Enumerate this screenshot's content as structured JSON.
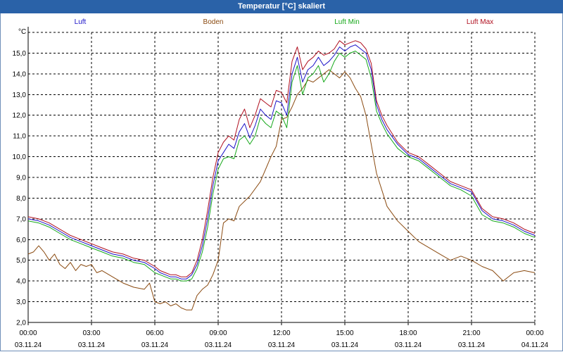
{
  "window": {
    "title": "Temperatur [°C] skaliert"
  },
  "colors": {
    "luft": "#1b12c8",
    "boden": "#8a4a10",
    "luft_min": "#16a81a",
    "luft_max": "#b01020",
    "titlebar": "#2a62a8"
  },
  "chart_data": {
    "type": "line",
    "title": "Temperatur [°C] skaliert",
    "ylabel": "°C",
    "xlabel": "",
    "ylim": [
      2.0,
      16.0
    ],
    "xlim": [
      0,
      24
    ],
    "grid": true,
    "legend_placement": "top",
    "y_ticks": [
      "2,0",
      "3,0",
      "4,0",
      "5,0",
      "6,0",
      "7,0",
      "8,0",
      "9,0",
      "10,0",
      "11,0",
      "12,0",
      "13,0",
      "14,0",
      "15,0"
    ],
    "x_ticks": [
      {
        "time": "00:00",
        "date": "03.11.24"
      },
      {
        "time": "03:00",
        "date": "03.11.24"
      },
      {
        "time": "06:00",
        "date": "03.11.24"
      },
      {
        "time": "09:00",
        "date": "03.11.24"
      },
      {
        "time": "12:00",
        "date": "03.11.24"
      },
      {
        "time": "15:00",
        "date": "03.11.24"
      },
      {
        "time": "18:00",
        "date": "03.11.24"
      },
      {
        "time": "21:00",
        "date": "03.11.24"
      },
      {
        "time": "00:00",
        "date": "04.11.24"
      }
    ],
    "series": [
      {
        "name": "Luft",
        "color": "#1b12c8",
        "x": [
          0,
          0.5,
          1,
          1.5,
          2,
          2.5,
          3,
          3.5,
          4,
          4.5,
          5,
          5.5,
          6,
          6.25,
          6.5,
          6.75,
          7,
          7.25,
          7.5,
          7.75,
          8,
          8.25,
          8.5,
          8.75,
          9,
          9.25,
          9.5,
          9.75,
          10,
          10.25,
          10.5,
          10.75,
          11,
          11.25,
          11.5,
          11.75,
          12,
          12.25,
          12.5,
          12.75,
          13,
          13.25,
          13.5,
          13.75,
          14,
          14.25,
          14.5,
          14.75,
          15,
          15.25,
          15.5,
          15.75,
          16,
          16.25,
          16.5,
          16.75,
          17,
          17.5,
          18,
          18.5,
          19,
          19.5,
          20,
          20.5,
          21,
          21.5,
          22,
          22.5,
          23,
          23.5,
          24
        ],
        "y": [
          7.0,
          6.9,
          6.7,
          6.4,
          6.1,
          5.9,
          5.7,
          5.5,
          5.3,
          5.2,
          5.0,
          4.9,
          4.6,
          4.4,
          4.3,
          4.2,
          4.2,
          4.1,
          4.1,
          4.3,
          4.8,
          5.7,
          7.0,
          8.6,
          9.8,
          10.2,
          10.6,
          10.4,
          11.2,
          11.6,
          10.9,
          11.5,
          12.3,
          12.0,
          11.8,
          12.7,
          12.6,
          12.0,
          14.0,
          14.8,
          13.6,
          14.2,
          14.4,
          14.8,
          14.4,
          14.6,
          14.9,
          15.3,
          15.1,
          15.3,
          15.4,
          15.2,
          15.0,
          14.2,
          12.5,
          11.8,
          11.3,
          10.6,
          10.1,
          9.9,
          9.5,
          9.1,
          8.7,
          8.5,
          8.3,
          7.4,
          7.0,
          6.9,
          6.7,
          6.4,
          6.2
        ]
      },
      {
        "name": "Boden",
        "color": "#8a4a10",
        "x": [
          0,
          0.25,
          0.5,
          0.75,
          1,
          1.25,
          1.5,
          1.75,
          2,
          2.25,
          2.5,
          2.75,
          3,
          3.25,
          3.5,
          4,
          4.5,
          5,
          5.5,
          5.75,
          6,
          6.25,
          6.5,
          6.75,
          7,
          7.25,
          7.5,
          7.75,
          8,
          8.25,
          8.5,
          8.75,
          9,
          9.25,
          9.5,
          9.75,
          10,
          10.5,
          11,
          11.5,
          11.75,
          12,
          12.25,
          12.5,
          12.75,
          13,
          13.25,
          13.5,
          13.75,
          14,
          14.25,
          14.5,
          14.75,
          15,
          15.25,
          15.5,
          15.75,
          16,
          16.5,
          17,
          17.5,
          18,
          18.5,
          19,
          19.5,
          20,
          20.5,
          21,
          21.5,
          22,
          22.5,
          23,
          23.5,
          24
        ],
        "y": [
          5.3,
          5.4,
          5.7,
          5.4,
          5.0,
          5.3,
          4.8,
          4.6,
          4.9,
          4.5,
          4.8,
          4.7,
          4.8,
          4.4,
          4.5,
          4.2,
          3.9,
          3.7,
          3.6,
          3.9,
          3.0,
          2.9,
          3.0,
          2.8,
          2.9,
          2.7,
          2.6,
          2.6,
          3.3,
          3.6,
          3.8,
          4.3,
          5.0,
          6.8,
          7.0,
          6.9,
          7.6,
          8.1,
          8.8,
          10.0,
          10.5,
          11.8,
          11.9,
          12.4,
          13.0,
          13.3,
          13.7,
          13.6,
          13.8,
          14.0,
          14.2,
          14.0,
          13.8,
          14.1,
          13.8,
          13.3,
          12.9,
          12.0,
          9.2,
          7.6,
          6.9,
          6.4,
          5.9,
          5.6,
          5.3,
          5.0,
          5.2,
          5.0,
          4.7,
          4.5,
          4.0,
          4.4,
          4.5,
          4.4
        ]
      },
      {
        "name": "Luft Min",
        "color": "#16a81a",
        "x": [
          0,
          0.5,
          1,
          1.5,
          2,
          2.5,
          3,
          3.5,
          4,
          4.5,
          5,
          5.5,
          6,
          6.25,
          6.5,
          6.75,
          7,
          7.25,
          7.5,
          7.75,
          8,
          8.25,
          8.5,
          8.75,
          9,
          9.25,
          9.5,
          9.75,
          10,
          10.25,
          10.5,
          10.75,
          11,
          11.25,
          11.5,
          11.75,
          12,
          12.25,
          12.5,
          12.75,
          13,
          13.25,
          13.5,
          13.75,
          14,
          14.25,
          14.5,
          14.75,
          15,
          15.25,
          15.5,
          15.75,
          16,
          16.25,
          16.5,
          16.75,
          17,
          17.5,
          18,
          18.5,
          19,
          19.5,
          20,
          20.5,
          21,
          21.5,
          22,
          22.5,
          23,
          23.5,
          24
        ],
        "y": [
          6.9,
          6.8,
          6.6,
          6.3,
          6.0,
          5.8,
          5.6,
          5.4,
          5.2,
          5.1,
          4.9,
          4.8,
          4.4,
          4.3,
          4.2,
          4.1,
          4.1,
          4.0,
          4.0,
          4.1,
          4.6,
          5.4,
          6.6,
          8.2,
          9.4,
          9.9,
          10.0,
          9.9,
          10.8,
          11.0,
          10.6,
          11.0,
          11.9,
          11.6,
          11.4,
          12.2,
          12.0,
          11.4,
          13.6,
          14.4,
          13.0,
          13.8,
          14.0,
          14.4,
          13.6,
          14.0,
          14.6,
          15.0,
          14.8,
          15.0,
          15.1,
          14.9,
          14.7,
          13.8,
          12.2,
          11.6,
          11.1,
          10.4,
          10.0,
          9.8,
          9.4,
          9.0,
          8.6,
          8.4,
          8.1,
          7.2,
          6.9,
          6.8,
          6.6,
          6.3,
          6.1
        ]
      },
      {
        "name": "Luft Max",
        "color": "#b01020",
        "x": [
          0,
          0.5,
          1,
          1.5,
          2,
          2.5,
          3,
          3.5,
          4,
          4.5,
          5,
          5.5,
          6,
          6.25,
          6.5,
          6.75,
          7,
          7.25,
          7.5,
          7.75,
          8,
          8.25,
          8.5,
          8.75,
          9,
          9.25,
          9.5,
          9.75,
          10,
          10.25,
          10.5,
          10.75,
          11,
          11.25,
          11.5,
          11.75,
          12,
          12.25,
          12.5,
          12.75,
          13,
          13.25,
          13.5,
          13.75,
          14,
          14.25,
          14.5,
          14.75,
          15,
          15.25,
          15.5,
          15.75,
          16,
          16.25,
          16.5,
          16.75,
          17,
          17.5,
          18,
          18.5,
          19,
          19.5,
          20,
          20.5,
          21,
          21.5,
          22,
          22.5,
          23,
          23.5,
          24
        ],
        "y": [
          7.1,
          7.0,
          6.8,
          6.5,
          6.2,
          6.0,
          5.8,
          5.6,
          5.4,
          5.3,
          5.1,
          5.0,
          4.7,
          4.5,
          4.4,
          4.3,
          4.3,
          4.2,
          4.2,
          4.4,
          5.0,
          6.0,
          7.4,
          9.0,
          10.2,
          10.7,
          11.0,
          10.8,
          11.8,
          12.3,
          11.4,
          12.0,
          12.8,
          12.6,
          12.4,
          13.2,
          13.1,
          12.6,
          14.6,
          15.3,
          14.2,
          14.6,
          14.8,
          15.1,
          14.9,
          15.0,
          15.2,
          15.6,
          15.4,
          15.5,
          15.6,
          15.5,
          15.2,
          14.5,
          12.7,
          12.0,
          11.5,
          10.7,
          10.2,
          10.0,
          9.6,
          9.2,
          8.8,
          8.6,
          8.4,
          7.5,
          7.1,
          7.0,
          6.8,
          6.5,
          6.3
        ]
      }
    ]
  }
}
